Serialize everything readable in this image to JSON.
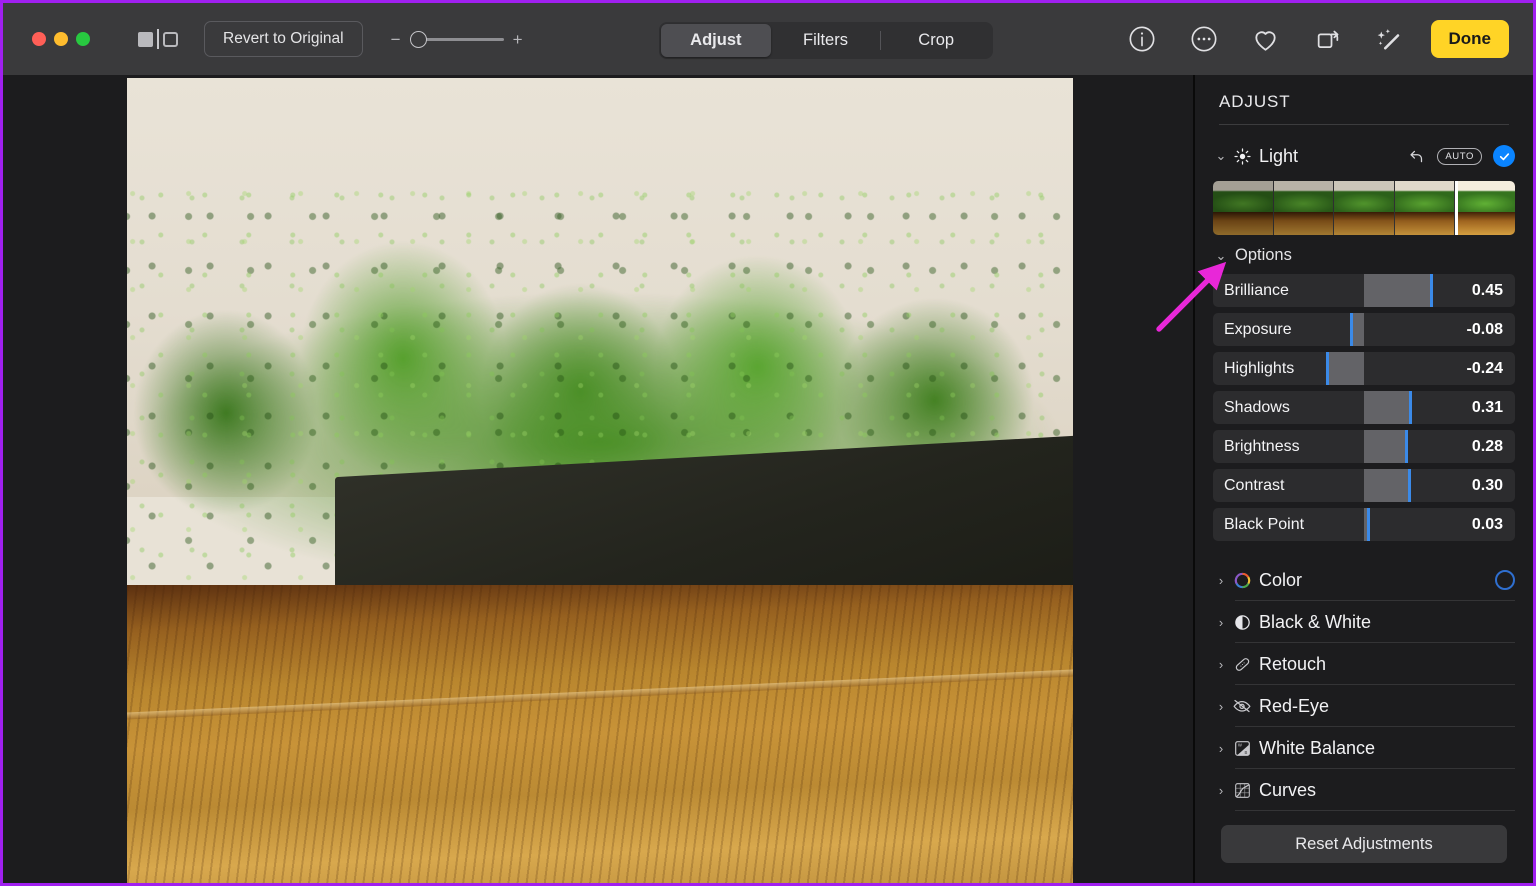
{
  "window": {
    "traffic_lights": [
      "close",
      "minimize",
      "zoom"
    ],
    "accent_done": "#ffd426",
    "accent_blue": "#0a84ff",
    "border_highlight": "#a020f0"
  },
  "toolbar": {
    "sidebar_toggle_icon": "sidebar-toggle-icon",
    "revert_label": "Revert to Original",
    "zoom": {
      "minus": "−",
      "plus": "+",
      "value": 0
    },
    "segments": [
      {
        "label": "Adjust",
        "active": true
      },
      {
        "label": "Filters",
        "active": false
      },
      {
        "label": "Crop",
        "active": false
      }
    ],
    "icons": [
      {
        "name": "info-icon"
      },
      {
        "name": "ellipsis-circle-icon"
      },
      {
        "name": "heart-icon"
      },
      {
        "name": "rotate-icon"
      },
      {
        "name": "auto-enhance-wand-icon"
      }
    ],
    "done_label": "Done"
  },
  "panel": {
    "title": "ADJUST",
    "light": {
      "label": "Light",
      "icon": "sun-icon",
      "revert_icon": "revert-icon",
      "auto_label": "AUTO",
      "enabled": true,
      "thumbnails": [
        {
          "index": 1,
          "selected": false
        },
        {
          "index": 2,
          "selected": false
        },
        {
          "index": 3,
          "selected": false
        },
        {
          "index": 4,
          "selected": false
        },
        {
          "index": 5,
          "selected": true
        }
      ],
      "options_label": "Options",
      "options_expanded": true,
      "sliders": [
        {
          "name": "Brilliance",
          "value": "0.45",
          "num": 0.45
        },
        {
          "name": "Exposure",
          "value": "-0.08",
          "num": -0.08
        },
        {
          "name": "Highlights",
          "value": "-0.24",
          "num": -0.24
        },
        {
          "name": "Shadows",
          "value": "0.31",
          "num": 0.31
        },
        {
          "name": "Brightness",
          "value": "0.28",
          "num": 0.28
        },
        {
          "name": "Contrast",
          "value": "0.30",
          "num": 0.3
        },
        {
          "name": "Black Point",
          "value": "0.03",
          "num": 0.03
        }
      ]
    },
    "sections": [
      {
        "label": "Color",
        "icon": "color-wheel-icon",
        "toggle": "ring"
      },
      {
        "label": "Black & White",
        "icon": "contrast-circle-icon",
        "toggle": "none"
      },
      {
        "label": "Retouch",
        "icon": "bandage-icon",
        "toggle": "none"
      },
      {
        "label": "Red-Eye",
        "icon": "eye-slash-icon",
        "toggle": "none"
      },
      {
        "label": "White Balance",
        "icon": "white-balance-icon",
        "toggle": "none"
      },
      {
        "label": "Curves",
        "icon": "curves-icon",
        "toggle": "none"
      }
    ],
    "reset_label": "Reset Adjustments"
  },
  "annotation": {
    "arrow_color": "#e827d8",
    "points_to": "options-chevron"
  }
}
